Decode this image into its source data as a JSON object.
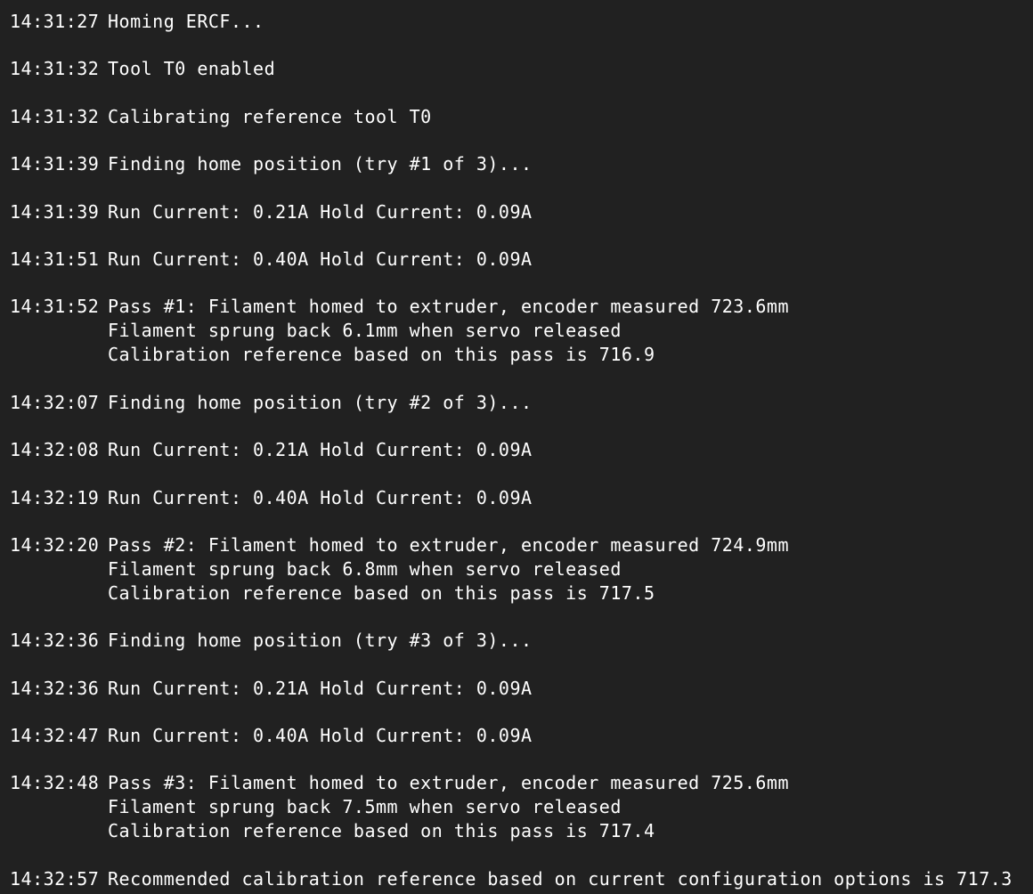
{
  "console": {
    "entries": [
      {
        "time": "14:31:27",
        "lines": [
          "Homing ERCF..."
        ]
      },
      {
        "time": "14:31:32",
        "lines": [
          "Tool T0 enabled"
        ]
      },
      {
        "time": "14:31:32",
        "lines": [
          "Calibrating reference tool T0"
        ]
      },
      {
        "time": "14:31:39",
        "lines": [
          "Finding home position (try #1 of 3)..."
        ]
      },
      {
        "time": "14:31:39",
        "lines": [
          "Run Current: 0.21A Hold Current: 0.09A"
        ]
      },
      {
        "time": "14:31:51",
        "lines": [
          "Run Current: 0.40A Hold Current: 0.09A"
        ]
      },
      {
        "time": "14:31:52",
        "lines": [
          "Pass #1: Filament homed to extruder, encoder measured 723.6mm",
          "Filament sprung back 6.1mm when servo released",
          "Calibration reference based on this pass is 716.9"
        ]
      },
      {
        "time": "14:32:07",
        "lines": [
          "Finding home position (try #2 of 3)..."
        ]
      },
      {
        "time": "14:32:08",
        "lines": [
          "Run Current: 0.21A Hold Current: 0.09A"
        ]
      },
      {
        "time": "14:32:19",
        "lines": [
          "Run Current: 0.40A Hold Current: 0.09A"
        ]
      },
      {
        "time": "14:32:20",
        "lines": [
          "Pass #2: Filament homed to extruder, encoder measured 724.9mm",
          "Filament sprung back 6.8mm when servo released",
          "Calibration reference based on this pass is 717.5"
        ]
      },
      {
        "time": "14:32:36",
        "lines": [
          "Finding home position (try #3 of 3)..."
        ]
      },
      {
        "time": "14:32:36",
        "lines": [
          "Run Current: 0.21A Hold Current: 0.09A"
        ]
      },
      {
        "time": "14:32:47",
        "lines": [
          "Run Current: 0.40A Hold Current: 0.09A"
        ]
      },
      {
        "time": "14:32:48",
        "lines": [
          "Pass #3: Filament homed to extruder, encoder measured 725.6mm",
          "Filament sprung back 7.5mm when servo released",
          "Calibration reference based on this pass is 717.4"
        ]
      },
      {
        "time": "14:32:57",
        "lines": [
          "Recommended calibration reference based on current configuration options is 717.3"
        ]
      }
    ]
  }
}
